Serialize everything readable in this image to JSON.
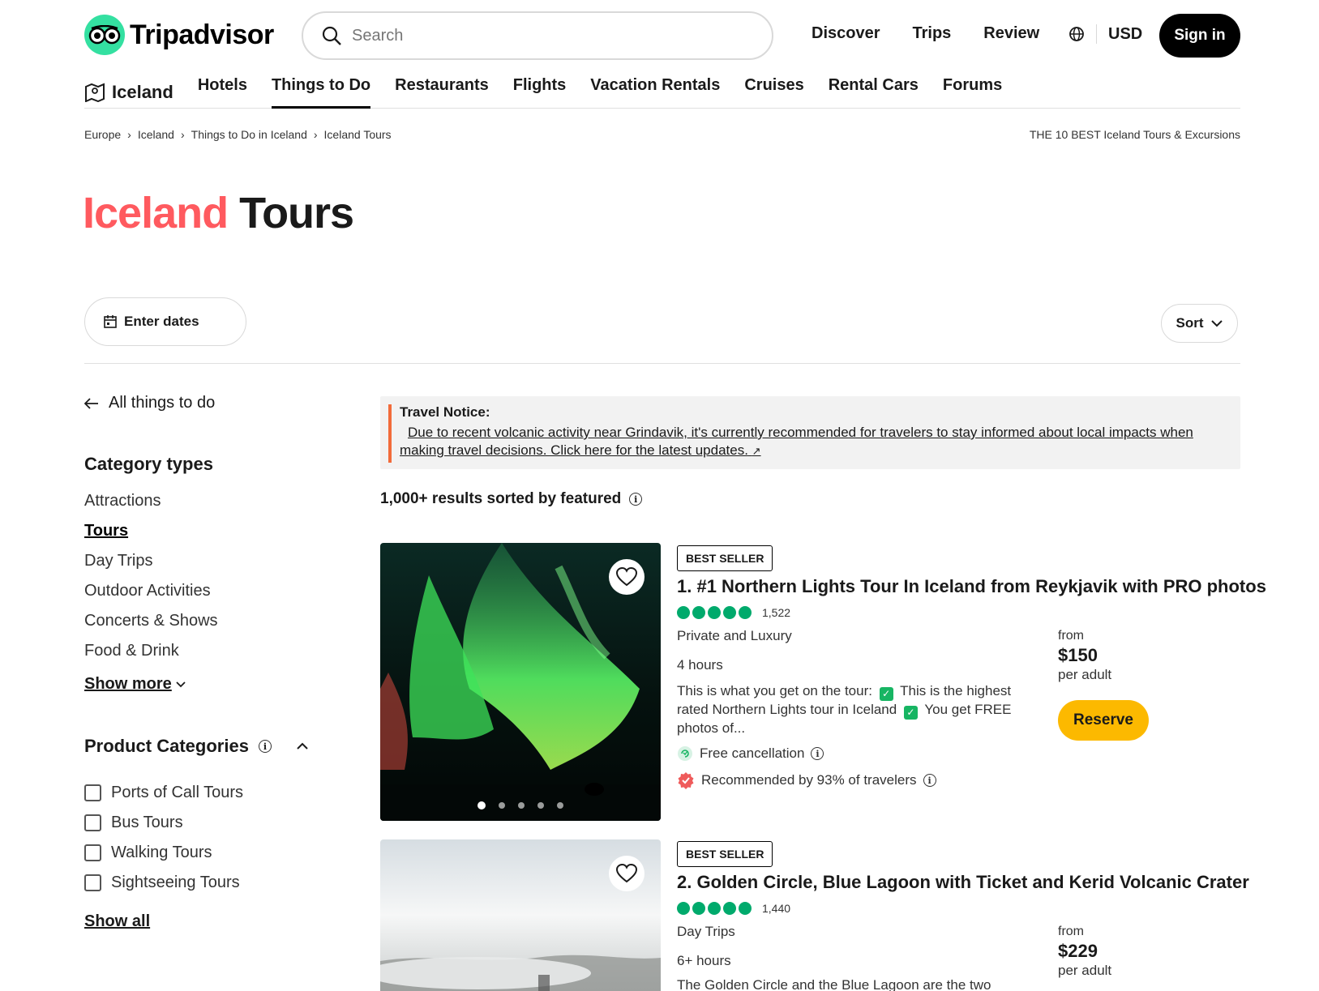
{
  "header": {
    "brand": "Tripadvisor",
    "search_placeholder": "Search",
    "links": [
      "Discover",
      "Trips",
      "Review"
    ],
    "currency": "USD",
    "signin": "Sign in"
  },
  "subnav": {
    "location": "Iceland",
    "items": [
      "Hotels",
      "Things to Do",
      "Restaurants",
      "Flights",
      "Vacation Rentals",
      "Cruises",
      "Rental Cars",
      "Forums"
    ],
    "active": "Things to Do"
  },
  "breadcrumb": {
    "items": [
      "Europe",
      "Iceland",
      "Things to Do in Iceland",
      "Iceland Tours"
    ],
    "right": "THE 10 BEST Iceland Tours & Excursions"
  },
  "title": {
    "place": "Iceland",
    "rest": "Tours"
  },
  "filters": {
    "dates": "Enter dates",
    "sort": "Sort"
  },
  "sidebar": {
    "back": "All things to do",
    "category_heading": "Category types",
    "categories": [
      "Attractions",
      "Tours",
      "Day Trips",
      "Outdoor Activities",
      "Concerts & Shows",
      "Food & Drink"
    ],
    "current_category": "Tours",
    "show_more": "Show more",
    "product_heading": "Product Categories",
    "products": [
      "Ports of Call Tours",
      "Bus Tours",
      "Walking Tours",
      "Sightseeing Tours"
    ],
    "show_all": "Show all"
  },
  "notice": {
    "title": "Travel Notice:",
    "body": "Due to recent volcanic activity near Grindavik, it's currently recommended for travelers to stay informed about local impacts when making travel decisions. Click here for the latest updates."
  },
  "results": "1,000+ results sorted by featured",
  "listings": [
    {
      "badge": "BEST SELLER",
      "title": "1. #1 Northern Lights Tour In Iceland from Reykjavik with PRO photos",
      "reviews": "1,522",
      "category": "Private and Luxury",
      "duration": "4 hours",
      "desc_a": "This is what you get on the tour:",
      "desc_b": "This is the highest rated Northern Lights tour in Iceland",
      "desc_c": "You get FREE photos of...",
      "cancellation": "Free cancellation",
      "recommended": "Recommended by 93% of travelers",
      "from": "from",
      "price": "$150",
      "per": "per adult",
      "reserve": "Reserve"
    },
    {
      "badge": "BEST SELLER",
      "title": "2. Golden Circle, Blue Lagoon with Ticket and Kerid Volcanic Crater",
      "reviews": "1,440",
      "category": "Day Trips",
      "duration": "6+ hours",
      "desc": "The Golden Circle and the Blue Lagoon are the two",
      "from": "from",
      "price": "$229",
      "per": "per adult"
    }
  ],
  "colors": {
    "brand_green": "#34e0a1",
    "title_red": "#ff5a5f",
    "reserve_yellow": "#fcb900",
    "rating_green": "#00aa6c"
  }
}
